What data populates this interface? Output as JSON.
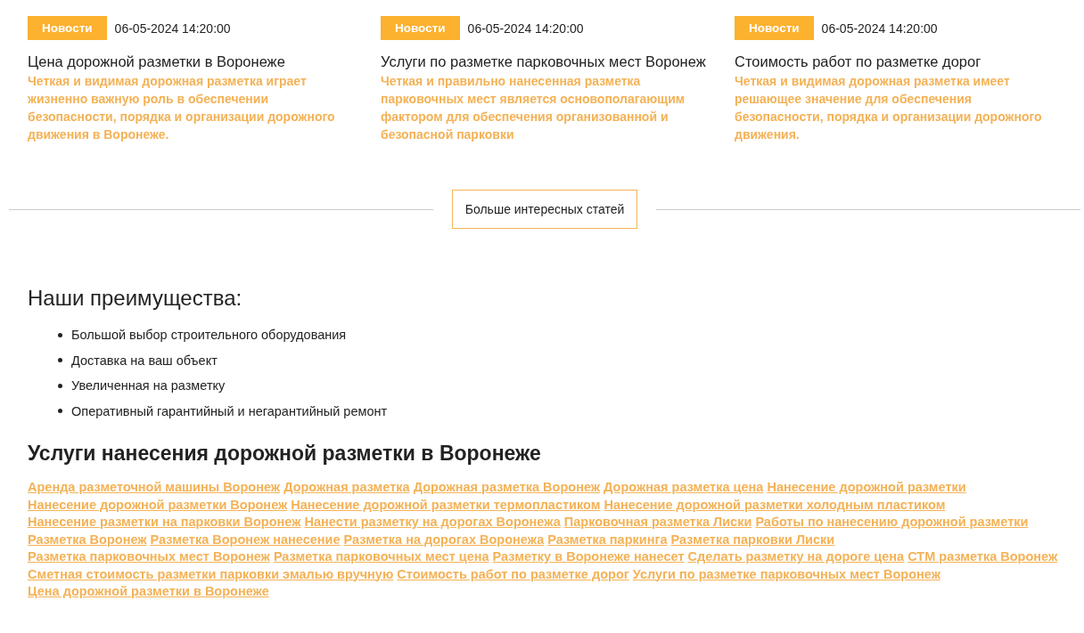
{
  "news": [
    {
      "tag": "Новости",
      "date": "06-05-2024 14:20:00",
      "title": "Цена дорожной разметки в Воронеже",
      "text": "Четкая и видимая дорожная разметка играет жизненно важную роль в обеспечении безопасности, порядка и организации дорожного движения в Воронеже."
    },
    {
      "tag": "Новости",
      "date": "06-05-2024 14:20:00",
      "title": "Услуги по разметке парковочных мест Воронеж",
      "text": "Четкая и правильно нанесенная разметка парковочных мест является основополагающим фактором для обеспечения организованной и безопасной парковки"
    },
    {
      "tag": "Новости",
      "date": "06-05-2024 14:20:00",
      "title": "Стоимость работ по разметке дорог",
      "text": "Четкая и видимая дорожная разметка имеет решающее значение для обеспечения безопасности, порядка и организации дорожного движения."
    }
  ],
  "more_button": "Больше интересных статей",
  "advantages": {
    "title": "Наши преимущества:",
    "items": [
      "Большой выбор строительного оборудования",
      "Доставка на ваш объект",
      "Увеличенная на разметку",
      "Оперативный гарантийный и негарантийный ремонт"
    ]
  },
  "services": {
    "title": "Услуги нанесения дорожной разметки в Воронеже",
    "links": [
      "Аренда разметочной машины Воронеж",
      "Дорожная разметка",
      "Дорожная разметка Воронеж",
      "Дорожная разметка цена",
      "Нанесение дорожной разметки",
      "Нанесение дорожной разметки Воронеж",
      "Нанесение дорожной разметки термопластиком",
      "Нанесение дорожной разметки холодным пластиком",
      "Нанесение разметки на парковки Воронеж",
      "Нанести разметку на дорогах Воронежа",
      "Парковочная разметка Лиски",
      "Работы по нанесению дорожной разметки",
      "Разметка Воронеж",
      "Разметка Воронеж нанесение",
      "Разметка на дорогах Воронежа",
      "Разметка паркинга",
      "Разметка парковки Лиски",
      "Разметка парковочных мест Воронеж",
      "Разметка парковочных мест цена",
      "Разметку в Воронеже нанесет",
      "Сделать разметку на дороге цена",
      "СТМ разметка Воронеж",
      "Сметная стоимость разметки парковки эмалью вручную",
      "Стоимость работ по разметке дорог",
      "Услуги по разметке парковочных мест Воронеж",
      "Цена дорожной разметки в Воронеже"
    ]
  }
}
